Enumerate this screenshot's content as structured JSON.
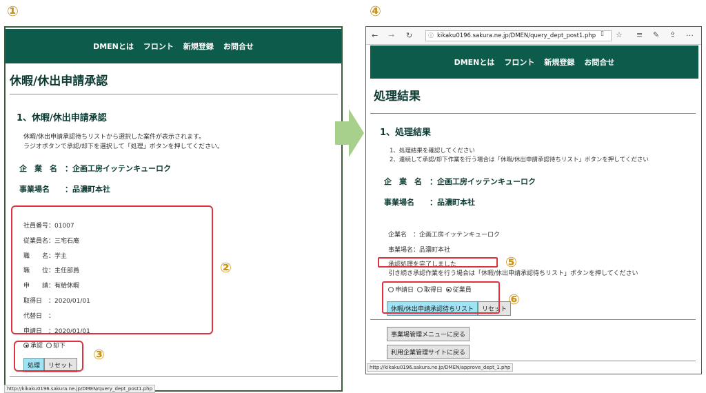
{
  "markers": {
    "m1": "①",
    "m2": "②",
    "m3": "③",
    "m4": "④",
    "m5": "⑤",
    "m6": "⑥"
  },
  "nav": [
    "DMENとは",
    "フロント",
    "新規登録",
    "お問合せ"
  ],
  "left": {
    "page_title": "休暇/休出申請承認",
    "section_title": "1、休暇/休出申請承認",
    "intro_lines": [
      "休暇/休出申請承認待ちリストから選択した案件が表示されます。",
      "ラジオボタンで承認/却下を選択して「処理」ボタンを押してください。"
    ],
    "company_label": "企　業　名　：企画工房イッテンキューロク",
    "office_label": "事業場名　　：品濃町本社",
    "details": [
      "社員番号：01007",
      "従業員名：三宅石庵",
      "職　　名：学主",
      "職　　位：主任部員",
      "申　　請：有給休暇",
      "取得日　：2020/01/01",
      "代替日　：",
      "申請日　：2020/01/01"
    ],
    "radio_approve": "承認",
    "radio_reject": "却下",
    "process_button": "処理",
    "reset_button": "リセット",
    "status_url": "http://kikaku0196.sakura.ne.jp/DMEN/query_dept_post1.php"
  },
  "right": {
    "url": "kikaku0196.sakura.ne.jp/DMEN/query_dept_post1.php",
    "page_title": "処理結果",
    "section_title": "1、処理結果",
    "intro_lines": [
      "1、処理結果を確認してください",
      "2、連続して承認/却下作業を行う場合は「休暇/休出申請承認待ちリスト」ボタンを押してください"
    ],
    "company_label": "企　業　名　：企画工房イッテンキューロク",
    "office_label": "事業場名　　：品濃町本社",
    "company_small": "企業名　：企画工房イッテンキューロク",
    "office_small": "事業場名：品濃町本社",
    "done_message": "承認処理を完了しました",
    "continue_message": "引き続き承認作業を行う場合は「休暇/休出申請承認待ちリスト」ボタンを押してください",
    "radio_apply_date": "申請日",
    "radio_get_date": "取得日",
    "radio_employee": "従業員",
    "list_button": "休暇/休出申請承認待ちリスト",
    "reset_button": "リセット",
    "back_office_button": "事業場管理メニューに戻る",
    "back_site_button": "利用企業管理サイトに戻る",
    "status_url": "http://kikaku0196.sakura.ne.jp/DMEN/approve_dept_1.php"
  }
}
